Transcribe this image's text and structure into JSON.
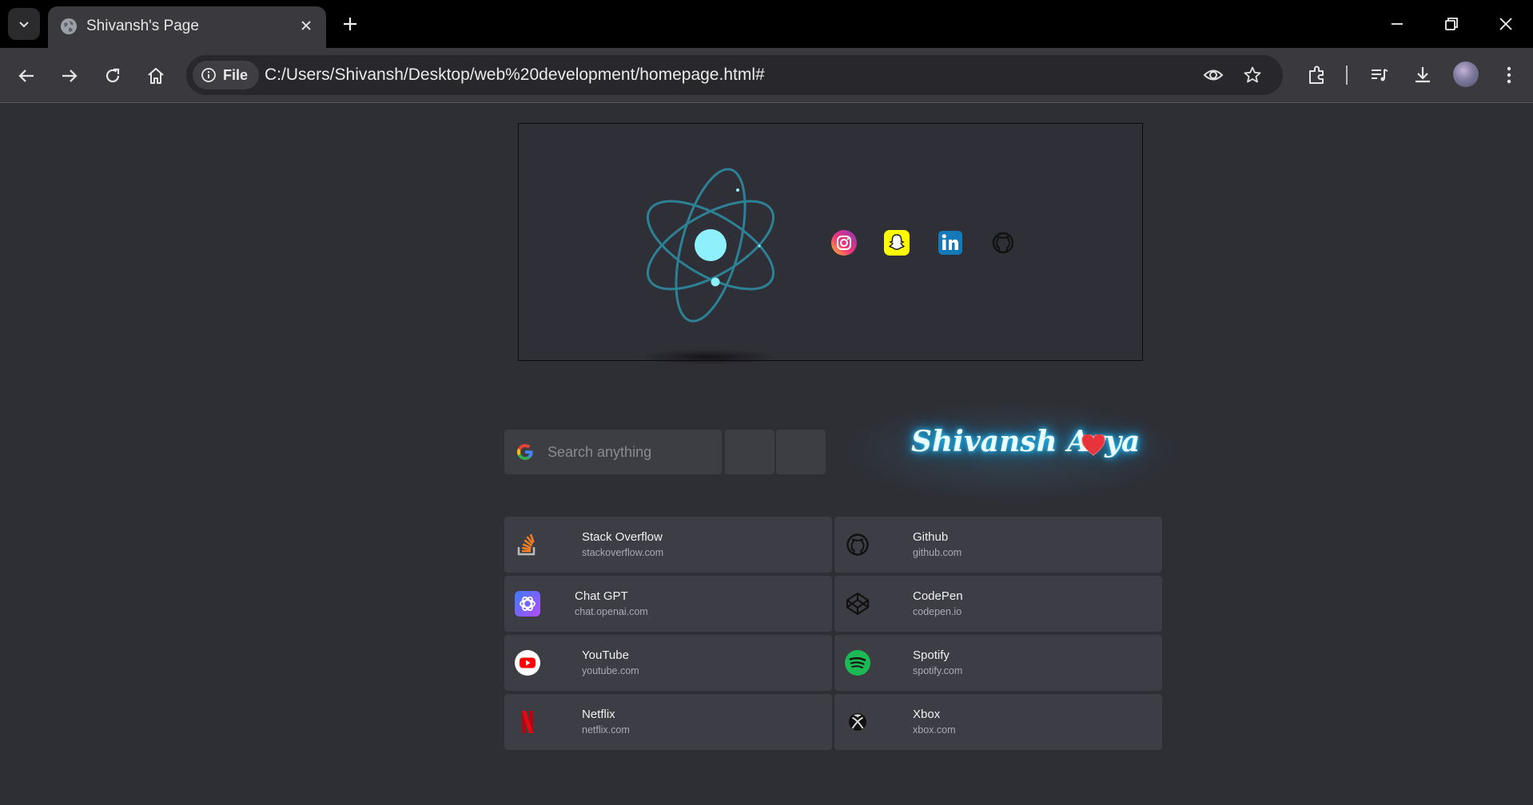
{
  "browser": {
    "tab": {
      "title": "Shivansh's Page"
    },
    "address_bar": {
      "scheme_label": "File",
      "url": "C:/Users/Shivansh/Desktop/web%20development/homepage.html#"
    }
  },
  "hero": {
    "social_icons": [
      "instagram-icon",
      "snapchat-icon",
      "linkedin-icon",
      "github-icon"
    ]
  },
  "search": {
    "placeholder": "Search anything"
  },
  "signature": {
    "name": "Shivansh Arya"
  },
  "links": [
    {
      "name": "Stack Overflow",
      "url": "stackoverflow.com",
      "icon": "stackoverflow-icon"
    },
    {
      "name": "Github",
      "url": "github.com",
      "icon": "github-icon"
    },
    {
      "name": "Chat GPT",
      "url": "chat.openai.com",
      "icon": "chatgpt-icon"
    },
    {
      "name": "CodePen",
      "url": "codepen.io",
      "icon": "codepen-icon"
    },
    {
      "name": "YouTube",
      "url": "youtube.com",
      "icon": "youtube-icon"
    },
    {
      "name": "Spotify",
      "url": "spotify.com",
      "icon": "spotify-icon"
    },
    {
      "name": "Netflix",
      "url": "netflix.com",
      "icon": "netflix-icon"
    },
    {
      "name": "Xbox",
      "url": "xbox.com",
      "icon": "xbox-icon"
    }
  ],
  "colors": {
    "page_background": "#2e2e35",
    "card_background": "#3d3d45",
    "signature_glow": "#2ec4ff",
    "atom_accent": "#8ef0fa"
  }
}
